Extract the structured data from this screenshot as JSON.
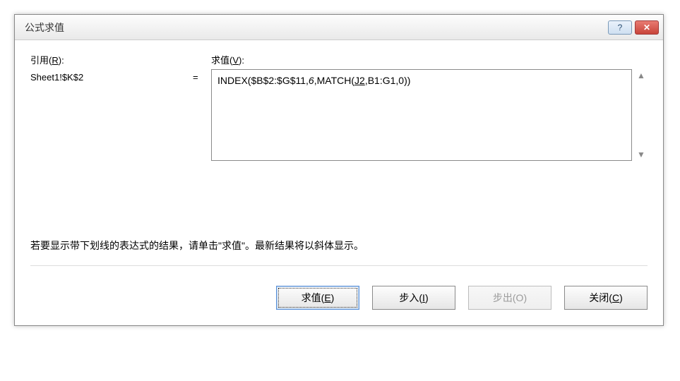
{
  "dialog": {
    "title": "公式求值",
    "help_icon": "?",
    "close_icon": "✕"
  },
  "labels": {
    "reference_label_pre": "引用(",
    "reference_hotkey": "R",
    "reference_label_post": "):",
    "evaluate_label_pre": "求值(",
    "evaluate_hotkey": "V",
    "evaluate_label_post": "):"
  },
  "reference_value": "Sheet1!$K$2",
  "equals": "=",
  "formula": {
    "prefix": "INDEX($B$2:$G$11,",
    "italic_part": "6",
    "middle": ",MATCH(",
    "underline_part": "J2",
    "suffix": ",B1:G1,0))"
  },
  "scroll": {
    "up": "▲",
    "down": "▼"
  },
  "hint": "若要显示带下划线的表达式的结果，请单击\"求值\"。最新结果将以斜体显示。",
  "buttons": {
    "evaluate_pre": "求值(",
    "evaluate_hot": "E",
    "evaluate_post": ")",
    "stepin_pre": "步入(",
    "stepin_hot": "I",
    "stepin_post": ")",
    "stepout_pre": "步出(",
    "stepout_hot": "O",
    "stepout_post": ")",
    "close_pre": "关闭(",
    "close_hot": "C",
    "close_post": ")"
  }
}
